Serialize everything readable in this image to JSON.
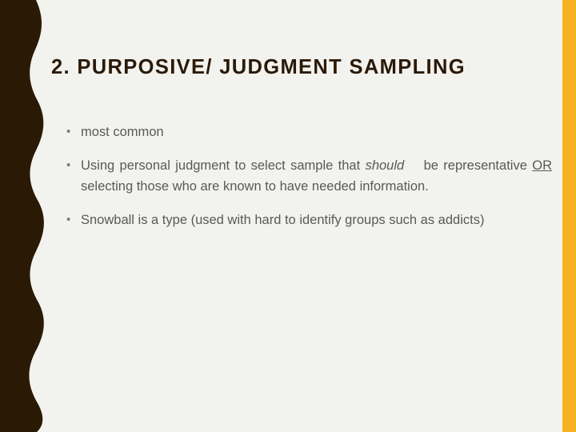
{
  "slide": {
    "title": "2. PURPOSIVE/ JUDGMENT SAMPLING",
    "background_color": "#F2F2EF",
    "accent_left_color": "#2A1A05",
    "accent_right_color": "#F5B324",
    "title_color": "#2A1A05",
    "body_color": "#595959",
    "bullet_marker": "•",
    "bullets": [
      {
        "id": "bullet-most-common",
        "text": "most common",
        "segments": [
          {
            "text": "most common",
            "style": "normal"
          }
        ]
      },
      {
        "id": "bullet-using-personal-judgment",
        "text": "Using personal judgment to select sample that should be representative OR selecting those who are known to have needed information.",
        "segments": [
          {
            "text": "Using personal judgment to select sample that ",
            "style": "normal"
          },
          {
            "text": "should",
            "style": "italic"
          },
          {
            "text": " be representative ",
            "style": "normal"
          },
          {
            "text": "OR",
            "style": "underline"
          },
          {
            "text": " selecting those who are known to have needed information.",
            "style": "normal"
          }
        ]
      },
      {
        "id": "bullet-snowball",
        "text": "Snowball is a type (used with hard to identify groups such as addicts)",
        "segments": [
          {
            "text": "Snowball is a type (used with hard to identify groups such as addicts)",
            "style": "normal"
          }
        ]
      }
    ]
  }
}
